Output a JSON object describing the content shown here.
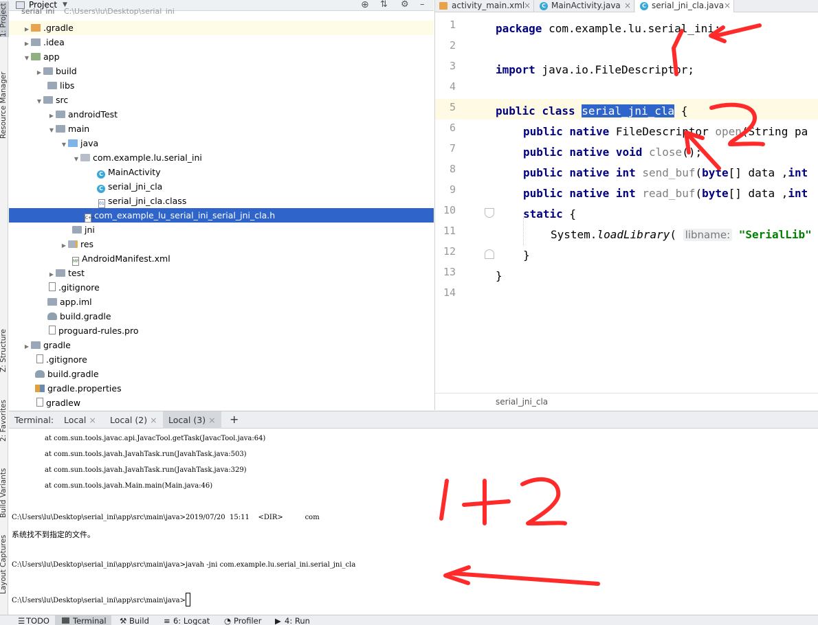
{
  "left_toolwindows": [
    "1: Project",
    "Resource Manager",
    "Z: Structure",
    "2: Favorites",
    "Build Variants",
    "Layout Captures"
  ],
  "project": {
    "title": "Project",
    "root_label": "serial_ini",
    "root_path": "C:\\Users\\lu\\Desktop\\serial_ini",
    "tree": [
      {
        "label": ".gradle",
        "icon": "orange-folder-icon"
      },
      {
        "label": ".idea",
        "icon": "folder-icon"
      },
      {
        "label": "app",
        "icon": "module-folder-icon"
      },
      {
        "label": "build",
        "icon": "folder-icon"
      },
      {
        "label": "libs",
        "icon": "folder-icon"
      },
      {
        "label": "src",
        "icon": "folder-icon"
      },
      {
        "label": "androidTest",
        "icon": "folder-icon"
      },
      {
        "label": "main",
        "icon": "folder-icon"
      },
      {
        "label": "java",
        "icon": "source-folder-icon"
      },
      {
        "label": "com.example.lu.serial_ini",
        "icon": "package-icon"
      },
      {
        "label": "MainActivity",
        "icon": "class-icon"
      },
      {
        "label": "serial_jni_cla",
        "icon": "class-icon"
      },
      {
        "label": "serial_jni_cla.class",
        "icon": "binary-file-icon"
      },
      {
        "label": "com_example_lu_serial_ini_serial_jni_cla.h",
        "icon": "c-header-file-icon"
      },
      {
        "label": "jni",
        "icon": "folder-icon"
      },
      {
        "label": "res",
        "icon": "resource-folder-icon"
      },
      {
        "label": "AndroidManifest.xml",
        "icon": "manifest-file-icon"
      },
      {
        "label": "test",
        "icon": "folder-icon"
      },
      {
        "label": ".gitignore",
        "icon": "text-file-icon"
      },
      {
        "label": "app.iml",
        "icon": "iml-file-icon"
      },
      {
        "label": "build.gradle",
        "icon": "gradle-icon"
      },
      {
        "label": "proguard-rules.pro",
        "icon": "text-file-icon"
      },
      {
        "label": "gradle",
        "icon": "folder-icon"
      },
      {
        "label": ".gitignore",
        "icon": "text-file-icon"
      },
      {
        "label": "build.gradle",
        "icon": "gradle-icon"
      },
      {
        "label": "gradle.properties",
        "icon": "properties-file-icon"
      },
      {
        "label": "gradlew",
        "icon": "text-file-icon"
      }
    ]
  },
  "editor": {
    "tabs": [
      {
        "label": "activity_main.xml",
        "icon": "xml-file-icon"
      },
      {
        "label": "MainActivity.java",
        "icon": "class-icon"
      },
      {
        "label": "serial_jni_cla.java",
        "icon": "class-icon"
      }
    ],
    "line_numbers": [
      "1",
      "2",
      "3",
      "4",
      "5",
      "6",
      "7",
      "8",
      "9",
      "10",
      "11",
      "12",
      "13",
      "14"
    ],
    "code": {
      "l1_kw": "package",
      "l1_rest": " com.example.lu.serial_ini;",
      "l3_kw": "import",
      "l3_rest": " java.io.FileDescriptor;",
      "l5_kw1": "public",
      "l5_kw2": "class",
      "l5_name": "serial_jni_cla",
      "l5_rest": " {",
      "l6_kw": "public native",
      "l6_type": " FileDescriptor ",
      "l6_method": "open",
      "l6_rest": "(String pa",
      "l7_kw": "public native void",
      "l7_method": " close",
      "l7_rest": "();",
      "l8_kw": "public native int",
      "l8_method": " send_buf",
      "l8_p1": "(",
      "l8_kw2": "byte",
      "l8_p2": "[] data ,",
      "l8_kw3": "int",
      "l9_kw": "public native int",
      "l9_method": " read_buf",
      "l9_p1": "(",
      "l9_kw2": "byte",
      "l9_p2": "[] data ,",
      "l9_kw3": "int",
      "l10_kw": "static",
      "l10_rest": " {",
      "l11_a": "System.",
      "l11_method": "loadLibrary",
      "l11_p": "(",
      "l11_hint": "libname:",
      "l11_str": "\"SerialLib\"",
      "l12": "}",
      "l13": "}"
    },
    "breadcrumb": "serial_jni_cla"
  },
  "terminal": {
    "label": "Terminal:",
    "tabs": [
      "Local",
      "Local (2)",
      "Local (3)"
    ],
    "add_tab": "+",
    "lines": [
      "at com.sun.tools.javac.api.JavacTool.getTask(JavacTool.java:64)",
      "at com.sun.tools.javah.JavahTask.run(JavahTask.java:503)",
      "at com.sun.tools.javah.JavahTask.run(JavahTask.java:329)",
      "at com.sun.tools.javah.Main.main(Main.java:46)",
      "C:\\Users\\lu\\Desktop\\serial_ini\\app\\src\\main\\java>2019/07/20  15:11    <DIR>          com",
      "系统找不到指定的文件。",
      "C:\\Users\\lu\\Desktop\\serial_ini\\app\\src\\main\\java>javah -jni com.example.lu.serial_ini.serial_jni_cla",
      "C:\\Users\\lu\\Desktop\\serial_ini\\app\\src\\main\\java>"
    ]
  },
  "bottom_tabs": [
    {
      "label": "TODO",
      "icon": "list-icon"
    },
    {
      "label": "Terminal",
      "icon": "terminal-icon"
    },
    {
      "label": "Build",
      "icon": "hammer-icon"
    },
    {
      "label": "6: Logcat",
      "icon": "logcat-icon"
    },
    {
      "label": "Profiler",
      "icon": "profiler-icon"
    },
    {
      "label": "4: Run",
      "icon": "run-icon"
    }
  ],
  "annotations": {
    "arrow_color": "#ff2a2a",
    "mark_1": "1",
    "mark_2": "2",
    "mark_1_plus_2": "1+2"
  }
}
